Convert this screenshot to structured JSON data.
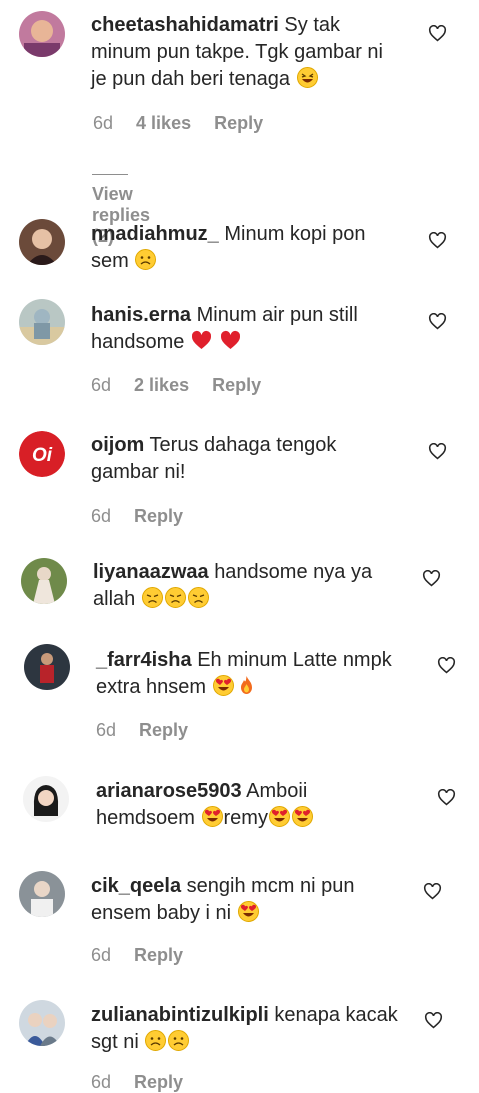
{
  "comments": [
    {
      "user": "cheetashahidamatri",
      "line1": "Sy tak",
      "line2": "minum pun takpe. Tgk gambar ni",
      "line3": "je pun dah beri tenaga",
      "time": "6d",
      "likes": "4 likes",
      "reply": "Reply",
      "view_replies": "View replies (2)"
    },
    {
      "user": "nnadiahmuz_",
      "line1": "Minum kopi pon",
      "line2": "sem"
    },
    {
      "user": "hanis.erna",
      "line1": "Minum air pun still",
      "line2": "handsome",
      "time": "6d",
      "likes": "2 likes",
      "reply": "Reply"
    },
    {
      "user": "oijom",
      "line1": "Terus dahaga tengok",
      "line2": "gambar ni!",
      "time": "6d",
      "reply": "Reply"
    },
    {
      "user": "liyanaazwaa",
      "line1": "handsome nya ya",
      "line2": "allah"
    },
    {
      "user": "_farr4isha",
      "line1": "Eh minum Latte nmpk",
      "line2": "extra hnsem",
      "time": "6d",
      "reply": "Reply"
    },
    {
      "user": "arianarose5903",
      "line1": "Amboii",
      "line2": "hemdsoem",
      "line2b": "remy"
    },
    {
      "user": "cik_qeela",
      "line1": "sengih mcm ni pun",
      "line2": "ensem baby i ni",
      "time": "6d",
      "reply": "Reply"
    },
    {
      "user": "zulianabintizulkipli",
      "line1": "kenapa kacak",
      "line2": "sgt ni",
      "time": "6d",
      "reply": "Reply"
    }
  ],
  "icons": {
    "like": "heart-outline-icon"
  },
  "colors": {
    "text": "#262626",
    "muted": "#8e8e8e",
    "heart": "#ed4956"
  }
}
